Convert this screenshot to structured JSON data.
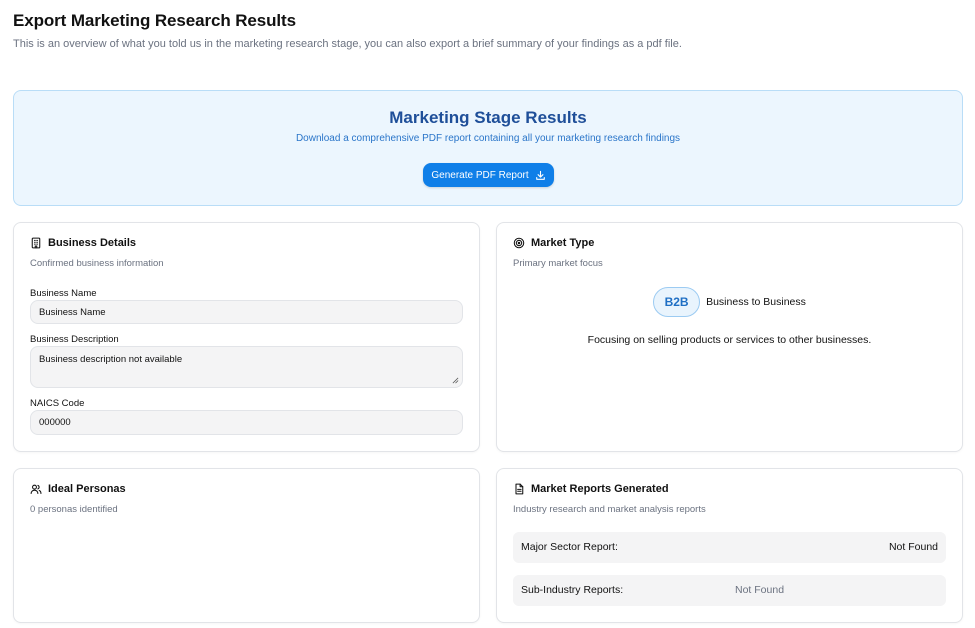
{
  "header": {
    "title": "Export Marketing Research Results",
    "subtitle": "This is an overview of what you told us in the marketing research stage, you can also export a brief summary of your findings as a pdf file."
  },
  "banner": {
    "title": "Marketing Stage Results",
    "subtitle": "Download a comprehensive PDF report containing all your marketing research findings",
    "button_label": "Generate PDF Report"
  },
  "business_details": {
    "title": "Business Details",
    "subtitle": "Confirmed business information",
    "name_label": "Business Name",
    "name_value": "Business Name",
    "description_label": "Business Description",
    "description_value": "Business description not available",
    "naics_label": "NAICS Code",
    "naics_value": "000000"
  },
  "market_type": {
    "title": "Market Type",
    "subtitle": "Primary market focus",
    "badge": "B2B",
    "badge_label": "Business to Business",
    "description": "Focusing on selling products or services to other businesses."
  },
  "ideal_personas": {
    "title": "Ideal Personas",
    "subtitle": "0 personas identified"
  },
  "market_reports": {
    "title": "Market Reports Generated",
    "subtitle": "Industry research and market analysis reports",
    "rows": [
      {
        "label": "Major Sector Report:",
        "value": "Not Found"
      },
      {
        "label": "Sub-Industry Reports:",
        "value": "Not Found"
      }
    ]
  },
  "colors": {
    "accent": "#0f7fe8",
    "banner_bg": "#ecf6fe",
    "banner_title": "#1f4f99"
  },
  "icons": {
    "business": "building-icon",
    "market": "target-icon",
    "personas": "users-icon",
    "reports": "document-icon",
    "download": "download-icon"
  }
}
